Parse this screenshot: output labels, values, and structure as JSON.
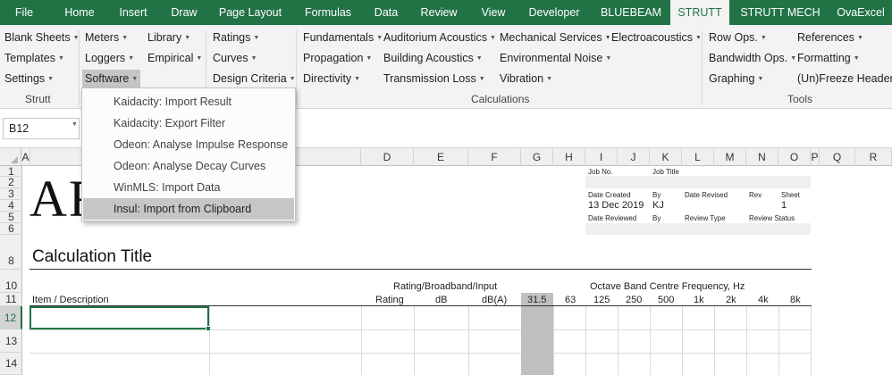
{
  "tabs": [
    "File",
    "Home",
    "Insert",
    "Draw",
    "Page Layout",
    "Formulas",
    "Data",
    "Review",
    "View",
    "Developer",
    "BLUEBEAM",
    "STRUTT",
    "STRUTT MECH",
    "OvaExcel"
  ],
  "ribbon": {
    "strutt_group": {
      "items": [
        "Blank Sheets",
        "Templates",
        "Settings"
      ],
      "label": "Strutt"
    },
    "meters": "Meters",
    "loggers": "Loggers",
    "software": "Software",
    "library": "Library",
    "empirical": "Empirical",
    "ratings": "Ratings",
    "curves": "Curves",
    "design_criteria": "Design Criteria",
    "calculations": {
      "col1": [
        "Fundamentals",
        "Propagation",
        "Directivity"
      ],
      "col2": [
        "Auditorium Acoustics",
        "Building Acoustics",
        "Transmission Loss"
      ],
      "col3": [
        "Mechanical Services",
        "Environmental Noise",
        "Vibration"
      ],
      "col4": [
        "Electroacoustics"
      ],
      "label": "Calculations"
    },
    "tools": {
      "col1": [
        "Row Ops.",
        "Bandwidth Ops.",
        "Graphing"
      ],
      "col2": [
        "References",
        "Formatting",
        "(Un)Freeze Headers"
      ],
      "label": "Tools"
    },
    "dropdown_glyph": "▼"
  },
  "formula_bar": {
    "name_box": "B12"
  },
  "software_menu": {
    "items": [
      "Kaidacity: Import Result",
      "Kaidacity: Export Filter",
      "Odeon: Analyse Impulse Response",
      "Odeon: Analyse Decay Curves",
      "WinMLS: Import Data",
      "Insul: Import from Clipboard"
    ]
  },
  "columns": [
    "A",
    "D",
    "E",
    "F",
    "G",
    "H",
    "I",
    "J",
    "K",
    "L",
    "M",
    "N",
    "O",
    "P",
    "Q",
    "R"
  ],
  "rows": [
    "1",
    "2",
    "3",
    "4",
    "5",
    "6",
    "8",
    "10",
    "11",
    "12",
    "13",
    "14"
  ],
  "sheet": {
    "logo_text": "AR",
    "info_block": {
      "job_no": "Job No.",
      "job_title": "Job Title",
      "date_created": "Date Created",
      "by": "By",
      "date_revised": "Date Revised",
      "rev": "Rev",
      "sheet": "Sheet",
      "date_created_value": "13 Dec 2019",
      "by_value": "KJ",
      "sheet_value": "1",
      "date_reviewed": "Date Reviewed",
      "by2": "By",
      "review_type": "Review Type",
      "review_status": "Review Status"
    },
    "calc_title": "Calculation Title",
    "rating_group": "Rating/Broadband/Input",
    "octave_group": "Octave Band Centre Frequency, Hz",
    "item_description": "Item / Description",
    "rating_cols": [
      "Rating",
      "dB",
      "dB(A)"
    ],
    "octave_cols": [
      "31.5",
      "63",
      "125",
      "250",
      "500",
      "1k",
      "2k",
      "4k",
      "8k"
    ]
  },
  "colors": {
    "excel_green": "#217346",
    "ribbon_bg": "#f3f3f3",
    "menu_hover": "#c6c6c6"
  }
}
